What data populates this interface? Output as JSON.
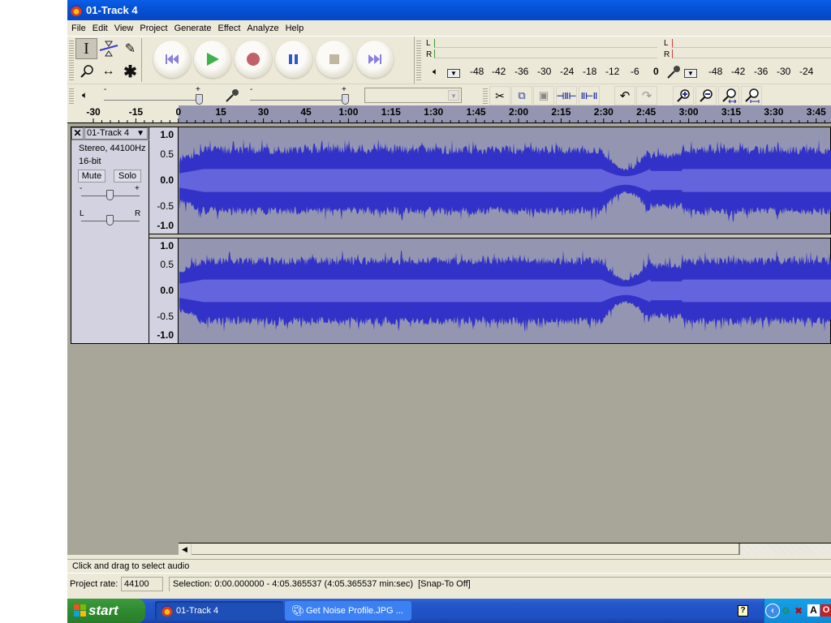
{
  "window": {
    "title": "01-Track 4"
  },
  "menu": [
    "File",
    "Edit",
    "View",
    "Project",
    "Generate",
    "Effect",
    "Analyze",
    "Help"
  ],
  "tools": [
    {
      "name": "selection-tool-icon",
      "glyph": "I",
      "active": true
    },
    {
      "name": "envelope-tool-icon",
      "glyph": "⧖",
      "active": false
    },
    {
      "name": "draw-tool-icon",
      "glyph": "✎",
      "active": false
    },
    {
      "name": "zoom-tool-icon",
      "glyph": "⚲",
      "active": false
    },
    {
      "name": "time-shift-tool-icon",
      "glyph": "↔",
      "active": false
    },
    {
      "name": "multi-tool-icon",
      "glyph": "✱",
      "active": false
    }
  ],
  "transport": [
    {
      "name": "skip-to-start-button",
      "icon": "skip-start-icon",
      "color": "#8a7fe0"
    },
    {
      "name": "play-button",
      "icon": "play-icon",
      "color": "#3fb14a"
    },
    {
      "name": "record-button",
      "icon": "record-icon",
      "color": "#c0606a"
    },
    {
      "name": "pause-button",
      "icon": "pause-icon",
      "color": "#2f56d6"
    },
    {
      "name": "stop-button",
      "icon": "stop-icon",
      "color": "#bfb7a0"
    },
    {
      "name": "skip-to-end-button",
      "icon": "skip-end-icon",
      "color": "#8a7fe0"
    }
  ],
  "meters": {
    "channel_labels": [
      "L",
      "R"
    ],
    "output_scale": [
      "-48",
      "-42",
      "-36",
      "-30",
      "-24",
      "-18",
      "-12",
      "-6",
      "0"
    ],
    "input_scale": [
      "-48",
      "-42",
      "-36",
      "-30",
      "-24"
    ]
  },
  "mixer": {
    "output_volume": 1.0,
    "input_volume": 1.0,
    "slider_minus": "-",
    "slider_plus": "+",
    "input_source": ""
  },
  "edit_toolbar": [
    "cut-icon",
    "copy-icon",
    "paste-icon",
    "trim-icon",
    "silence-icon",
    "undo-icon",
    "redo-icon",
    "zoom-in-icon",
    "zoom-out-icon",
    "fit-selection-icon",
    "fit-project-icon"
  ],
  "ruler": {
    "labels": [
      "-30",
      "-15",
      "0",
      "15",
      "30",
      "45",
      "1:00",
      "1:15",
      "1:30",
      "1:45",
      "2:00",
      "2:15",
      "2:30",
      "2:45",
      "3:00",
      "3:15",
      "3:30",
      "3:45"
    ]
  },
  "track": {
    "name": "01-Track 4",
    "format": "Stereo, 44100Hz",
    "bitdepth": "16-bit",
    "mute_label": "Mute",
    "solo_label": "Solo",
    "gain_minus": "-",
    "gain_plus": "+",
    "pan_left": "L",
    "pan_right": "R",
    "gain_value": 0.5,
    "pan_value": 0.5,
    "amplitude_labels": [
      "1.0",
      "0.5",
      "0.0",
      "-0.5",
      "-1.0"
    ],
    "colors": {
      "wave_peak": "#3232c8",
      "wave_rms": "#6464dc",
      "background": "#9496b1"
    }
  },
  "status": {
    "hint": "Click and drag to select audio",
    "project_rate_label": "Project rate:",
    "project_rate": "44100",
    "selection": "Selection: 0:00.000000 - 4:05.365537 (4:05.365537 min:sec)  [Snap-To Off]"
  },
  "taskbar": {
    "start_label": "start",
    "tasks": [
      {
        "label": "01-Track 4",
        "active": true
      },
      {
        "label": "Get Noise Profile.JPG ...",
        "active": false
      }
    ],
    "tray_icons": [
      "help-icon",
      "show-hidden-icon",
      "network-icon",
      "network-disconnected-icon",
      "antivirus-icon",
      "office-icon"
    ]
  }
}
